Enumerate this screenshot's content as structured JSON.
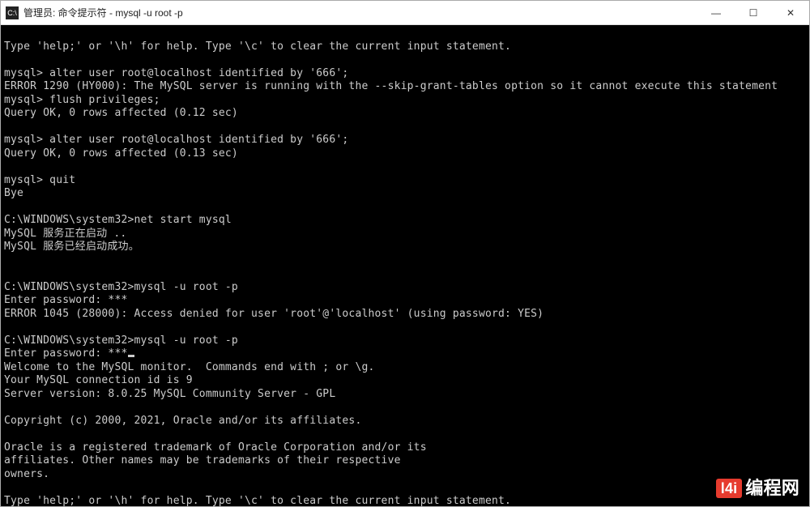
{
  "titlebar": {
    "icon_label": "C:\\",
    "text": "管理员: 命令提示符 - mysql  -u root -p"
  },
  "window_controls": {
    "minimize": "—",
    "maximize": "☐",
    "close": "✕"
  },
  "terminal": {
    "lines": [
      "Type 'help;' or '\\h' for help. Type '\\c' to clear the current input statement.",
      "",
      "mysql> alter user root@localhost identified by '666';",
      "ERROR 1290 (HY000): The MySQL server is running with the --skip-grant-tables option so it cannot execute this statement",
      "mysql> flush privileges;",
      "Query OK, 0 rows affected (0.12 sec)",
      "",
      "mysql> alter user root@localhost identified by '666';",
      "Query OK, 0 rows affected (0.13 sec)",
      "",
      "mysql> quit",
      "Bye",
      "",
      "C:\\WINDOWS\\system32>net start mysql",
      "MySQL 服务正在启动 ..",
      "MySQL 服务已经启动成功。",
      "",
      "",
      "C:\\WINDOWS\\system32>mysql -u root -p",
      "Enter password: ***",
      "ERROR 1045 (28000): Access denied for user 'root'@'localhost' (using password: YES)",
      "",
      "C:\\WINDOWS\\system32>mysql -u root -p",
      "Enter password: ***",
      "Welcome to the MySQL monitor.  Commands end with ; or \\g.",
      "Your MySQL connection id is 9",
      "Server version: 8.0.25 MySQL Community Server - GPL",
      "",
      "Copyright (c) 2000, 2021, Oracle and/or its affiliates.",
      "",
      "Oracle is a registered trademark of Oracle Corporation and/or its",
      "affiliates. Other names may be trademarks of their respective",
      "owners.",
      "",
      "Type 'help;' or '\\h' for help. Type '\\c' to clear the current input statement."
    ]
  },
  "watermark": {
    "badge": "l4i",
    "text": "编程网"
  }
}
